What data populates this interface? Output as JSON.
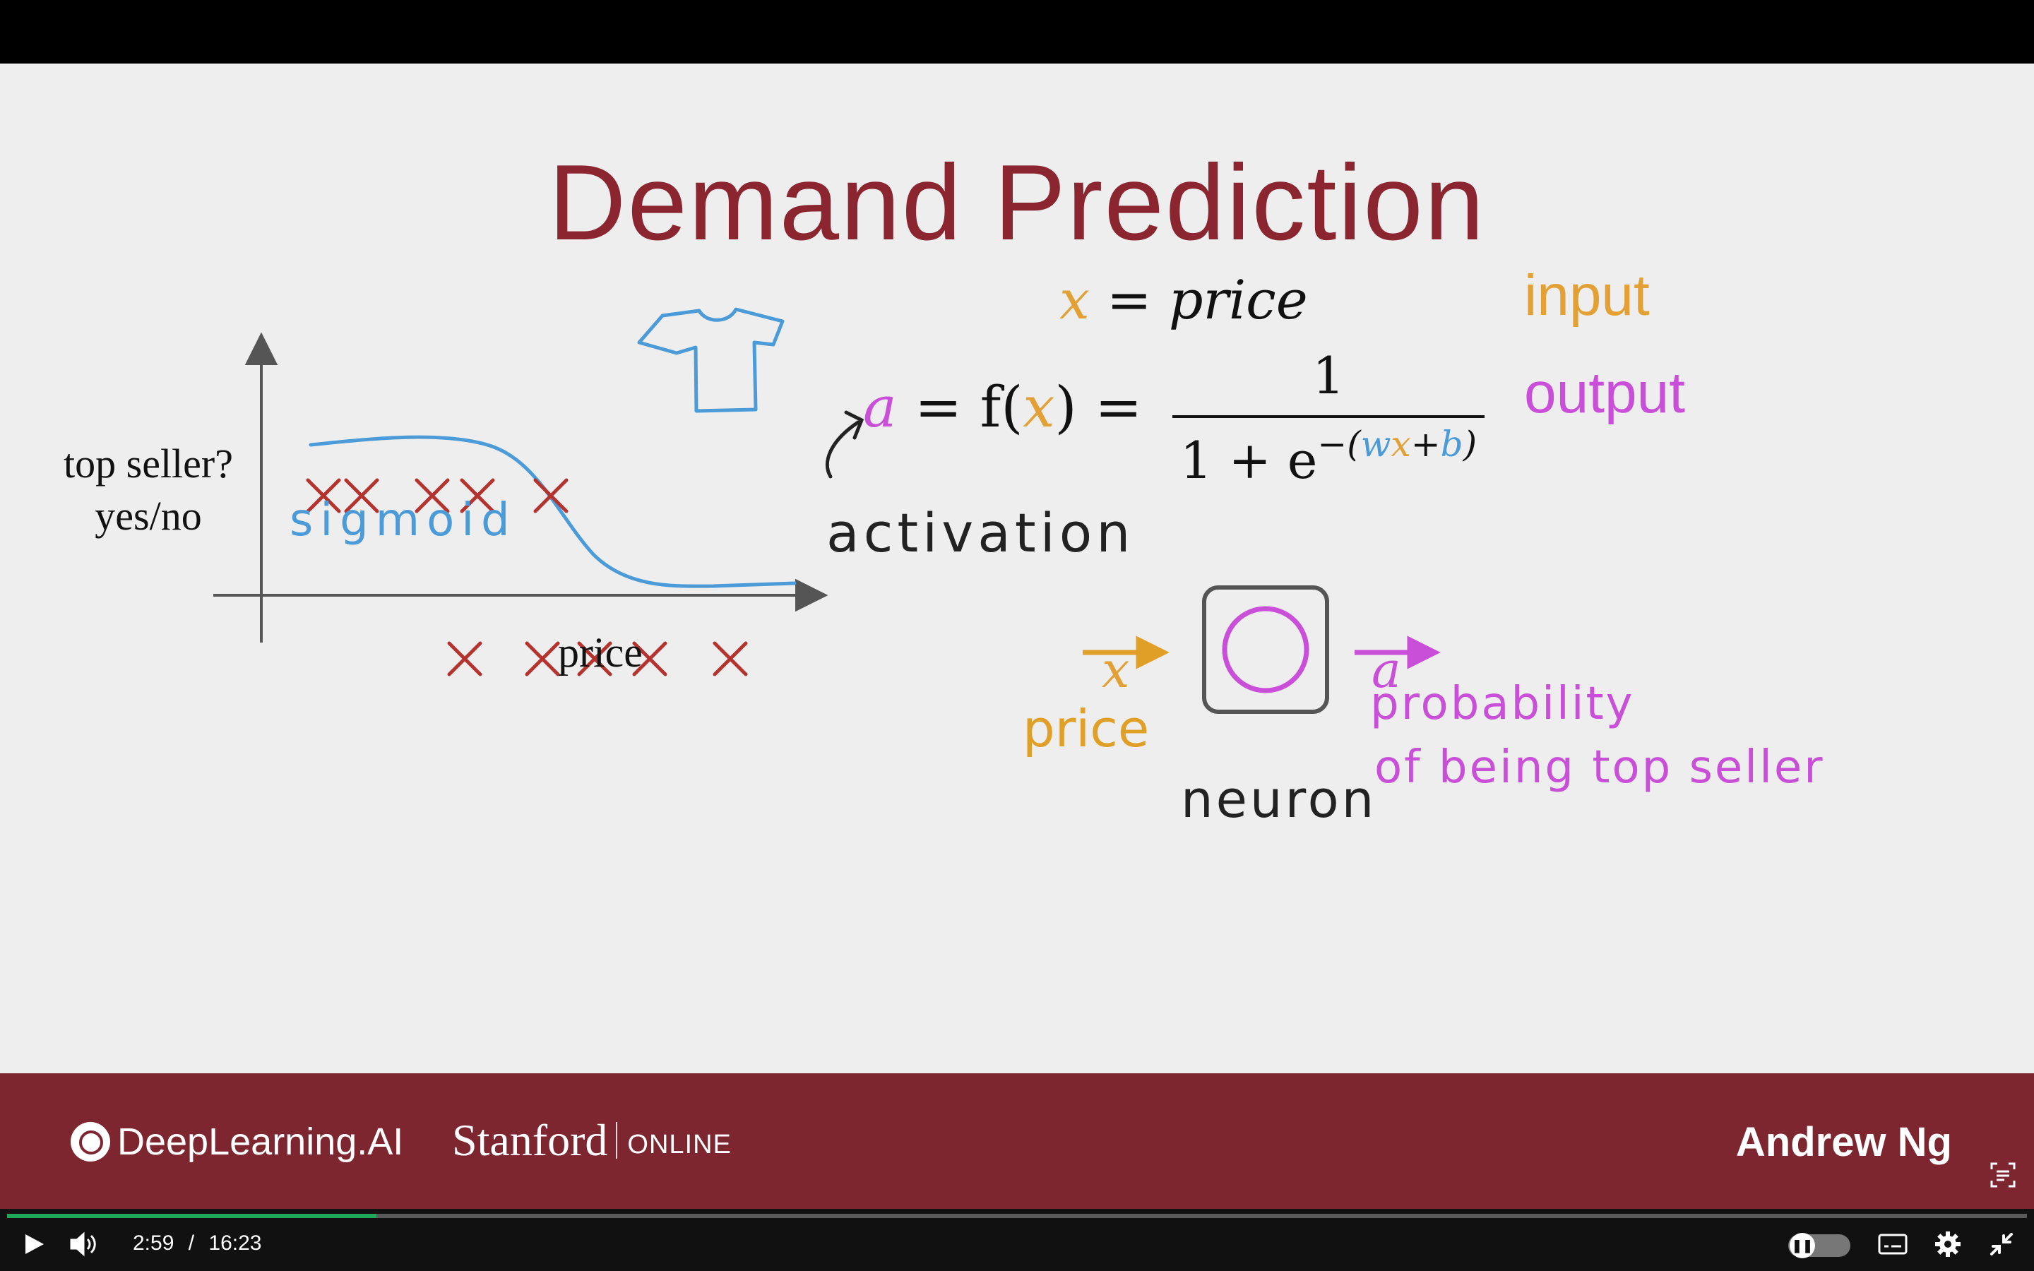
{
  "slide": {
    "title": "Demand Prediction",
    "graph": {
      "ylabel_line1": "top seller?",
      "ylabel_line2": "yes/no",
      "xlabel": "price",
      "curve_label": "sigmoid"
    },
    "equation1": {
      "lhs": "x",
      "rhs": "= price",
      "tag": "input"
    },
    "equation2": {
      "a": "a",
      "mid1": " = f(",
      "x": "x",
      "mid2": ") =",
      "numerator": "1",
      "den_prefix": "1 + e",
      "exp_open": "−(",
      "w": "w",
      "ex": "x",
      "plus": "+",
      "b": "b",
      "exp_close": ")",
      "tag": "output"
    },
    "activation_label": "activation",
    "neuron_diagram": {
      "input_symbol": "x",
      "input_label": "price",
      "output_symbol": "a",
      "neuron_label": "neuron",
      "output_label_line1": "probability",
      "output_label_line2": "of being top seller"
    }
  },
  "footer": {
    "brand1": "DeepLearning.AI",
    "brand2_name": "Stanford",
    "brand2_suffix": "ONLINE",
    "presenter": "Andrew Ng"
  },
  "player": {
    "current_time": "2:59",
    "separator": "/",
    "duration": "16:23",
    "progress": 0.183,
    "play_icon": "play-icon",
    "volume_icon": "volume-icon",
    "captions_icon": "captions-icon",
    "settings_icon": "gear-icon",
    "exit_fullscreen_icon": "exit-fullscreen-icon"
  },
  "colors": {
    "title": "#8b2530",
    "footer": "#7d2630",
    "input": "#e3a135",
    "output": "#c94fd8",
    "curve": "#4a9bd8",
    "cross": "#b5332f",
    "progress": "#1fa85a"
  }
}
